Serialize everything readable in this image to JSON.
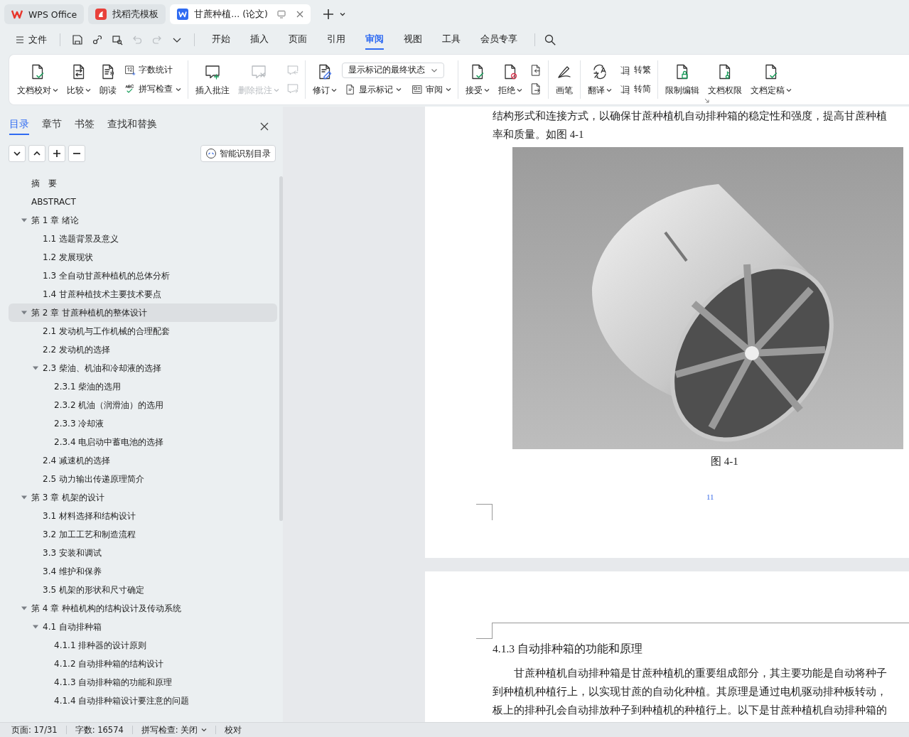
{
  "tabs": [
    {
      "label": "WPS Office",
      "selected": false,
      "kind": "home"
    },
    {
      "label": "找稻壳模板",
      "selected": false,
      "kind": "template"
    },
    {
      "label": "甘蔗种植... (论文)",
      "selected": true,
      "kind": "document"
    }
  ],
  "menu": {
    "file": "文件",
    "quick_actions": [
      {
        "disabled": false
      },
      {
        "disabled": false
      },
      {
        "disabled": false
      },
      {
        "disabled": true
      },
      {
        "disabled": true
      },
      {
        "disabled": false
      }
    ],
    "tabs": [
      {
        "label": "开始",
        "selected": false
      },
      {
        "label": "插入",
        "selected": false
      },
      {
        "label": "页面",
        "selected": false
      },
      {
        "label": "引用",
        "selected": false
      },
      {
        "label": "审阅",
        "selected": true
      },
      {
        "label": "视图",
        "selected": false
      },
      {
        "label": "工具",
        "selected": false
      },
      {
        "label": "会员专享",
        "selected": false
      }
    ]
  },
  "ribbon": {
    "groups": [
      {
        "items": [
          {
            "kind": "large",
            "label": "文档校对",
            "menu": true,
            "disabled": false
          },
          {
            "kind": "large",
            "label": "比较",
            "menu": true,
            "disabled": false
          },
          {
            "kind": "large",
            "label": "朗读",
            "menu": false,
            "disabled": false
          },
          {
            "kind": "stack",
            "rows": [
              {
                "label": "字数统计",
                "menu": false,
                "disabled": false
              },
              {
                "label": "拼写检查",
                "menu": true,
                "disabled": false
              }
            ]
          }
        ]
      },
      {
        "items": [
          {
            "kind": "large",
            "label": "插入批注",
            "menu": false,
            "disabled": false
          },
          {
            "kind": "large",
            "label": "删除批注",
            "menu": true,
            "disabled": true
          },
          {
            "kind": "icons",
            "buttons": [
              {
                "disabled": true
              },
              {
                "disabled": true
              }
            ]
          }
        ]
      },
      {
        "items": [
          {
            "kind": "large",
            "label": "修订",
            "menu": true,
            "disabled": false
          },
          {
            "kind": "combo",
            "value": "显示标记的最终状态",
            "rows": [
              {
                "label": "显示标记",
                "menu": true,
                "disabled": false
              },
              {
                "label": "审阅",
                "menu": true,
                "disabled": false
              }
            ]
          }
        ]
      },
      {
        "items": [
          {
            "kind": "large",
            "label": "接受",
            "menu": true,
            "disabled": false
          },
          {
            "kind": "large",
            "label": "拒绝",
            "menu": true,
            "disabled": false
          },
          {
            "kind": "icons",
            "buttons": [
              {
                "disabled": false
              },
              {
                "disabled": false
              }
            ]
          }
        ]
      },
      {
        "items": [
          {
            "kind": "large",
            "label": "画笔",
            "menu": false,
            "disabled": false
          }
        ]
      },
      {
        "items": [
          {
            "kind": "large",
            "label": "翻译",
            "menu": true,
            "disabled": false
          },
          {
            "kind": "stack",
            "rows": [
              {
                "label": "转繁",
                "menu": false,
                "disabled": false
              },
              {
                "label": "转简",
                "menu": false,
                "disabled": false
              }
            ]
          }
        ]
      },
      {
        "items": [
          {
            "kind": "large",
            "label": "限制编辑",
            "menu": false,
            "disabled": false
          },
          {
            "kind": "large",
            "label": "文档权限",
            "menu": false,
            "disabled": false
          },
          {
            "kind": "large",
            "label": "文档定稿",
            "menu": true,
            "disabled": false
          }
        ]
      }
    ]
  },
  "panel": {
    "tabs": [
      {
        "label": "目录",
        "selected": true
      },
      {
        "label": "章节",
        "selected": false
      },
      {
        "label": "书签",
        "selected": false
      },
      {
        "label": "查找和替换",
        "selected": false
      }
    ],
    "smart_button": "智能识别目录",
    "outline": [
      {
        "label": "摘　要",
        "selected": false
      },
      {
        "label": "ABSTRACT",
        "selected": false
      },
      {
        "label": "第 1 章  绪论",
        "selected": false,
        "expanded": true,
        "children": [
          {
            "label": "1.1 选题背景及意义",
            "selected": false
          },
          {
            "label": "1.2 发展现状",
            "selected": false
          },
          {
            "label": "1.3 全自动甘蔗种植机的总体分析",
            "selected": false
          },
          {
            "label": "1.4 甘蔗种植技术主要技术要点",
            "selected": false
          }
        ]
      },
      {
        "label": "第 2 章  甘蔗种植机的整体设计",
        "selected": true,
        "expanded": true,
        "children": [
          {
            "label": "2.1 发动机与工作机械的合理配套",
            "selected": false
          },
          {
            "label": "2.2 发动机的选择",
            "selected": false
          },
          {
            "label": "2.3 柴油、机油和冷却液的选择",
            "selected": false,
            "expanded": true,
            "children": [
              {
                "label": "2.3.1 柴油的选用",
                "selected": false
              },
              {
                "label": "2.3.2 机油（润滑油）的选用",
                "selected": false
              },
              {
                "label": "2.3.3 冷却液",
                "selected": false
              },
              {
                "label": "2.3.4 电启动中蓄电池的选择",
                "selected": false
              }
            ]
          },
          {
            "label": "2.4 减速机的选择",
            "selected": false
          },
          {
            "label": "2.5 动力输出传递原理简介",
            "selected": false
          }
        ]
      },
      {
        "label": "第 3 章  机架的设计",
        "selected": false,
        "expanded": true,
        "children": [
          {
            "label": "3.1 材料选择和结构设计",
            "selected": false
          },
          {
            "label": "3.2 加工工艺和制造流程",
            "selected": false
          },
          {
            "label": "3.3 安装和调试",
            "selected": false
          },
          {
            "label": "3.4 维护和保养",
            "selected": false
          },
          {
            "label": "3.5  机架的形状和尺寸确定",
            "selected": false
          }
        ]
      },
      {
        "label": "第 4 章  种植机构的结构设计及传动系统",
        "selected": false,
        "expanded": true,
        "children": [
          {
            "label": "4.1 自动排种箱",
            "selected": false,
            "expanded": true,
            "children": [
              {
                "label": "4.1.1 排种器的设计原则",
                "selected": false
              },
              {
                "label": "4.1.2 自动排种箱的结构设计",
                "selected": false
              },
              {
                "label": "4.1.3 自动排种箱的功能和原理",
                "selected": false
              },
              {
                "label": "4.1.4 自动排种箱设计要注意的问题",
                "selected": false
              }
            ]
          }
        ]
      }
    ]
  },
  "document": {
    "page_1": {
      "lines": [
        {
          "text": "结构形式和连接方式，以确保甘蔗种植机自动排种箱的稳定性和强度，提高甘蔗种植",
          "indent": false
        },
        {
          "text": "率和质量。如图 4-1",
          "indent": false
        }
      ],
      "caption": "图 4-1",
      "page_number": "11"
    },
    "page_2": {
      "heading": "4.1.3 自动排种箱的功能和原理",
      "lines": [
        {
          "text": "甘蔗种植机自动排种箱是甘蔗种植机的重要组成部分，其主要功能是自动将种子",
          "indent": true
        },
        {
          "text": "到种植机种植行上，以实现甘蔗的自动化种植。其原理是通过电机驱动排种板转动，",
          "indent": false
        },
        {
          "text": "板上的排种孔会自动排放种子到种植机的种植行上。以下是甘蔗种植机自动排种箱的",
          "indent": false
        }
      ]
    }
  },
  "status_bar": [
    {
      "label": "页面: 17/31",
      "menu": false
    },
    {
      "label": "字数: 16574",
      "menu": false
    },
    {
      "label": "拼写检查: 关闭",
      "menu": true
    },
    {
      "label": "校对",
      "menu": false
    }
  ]
}
